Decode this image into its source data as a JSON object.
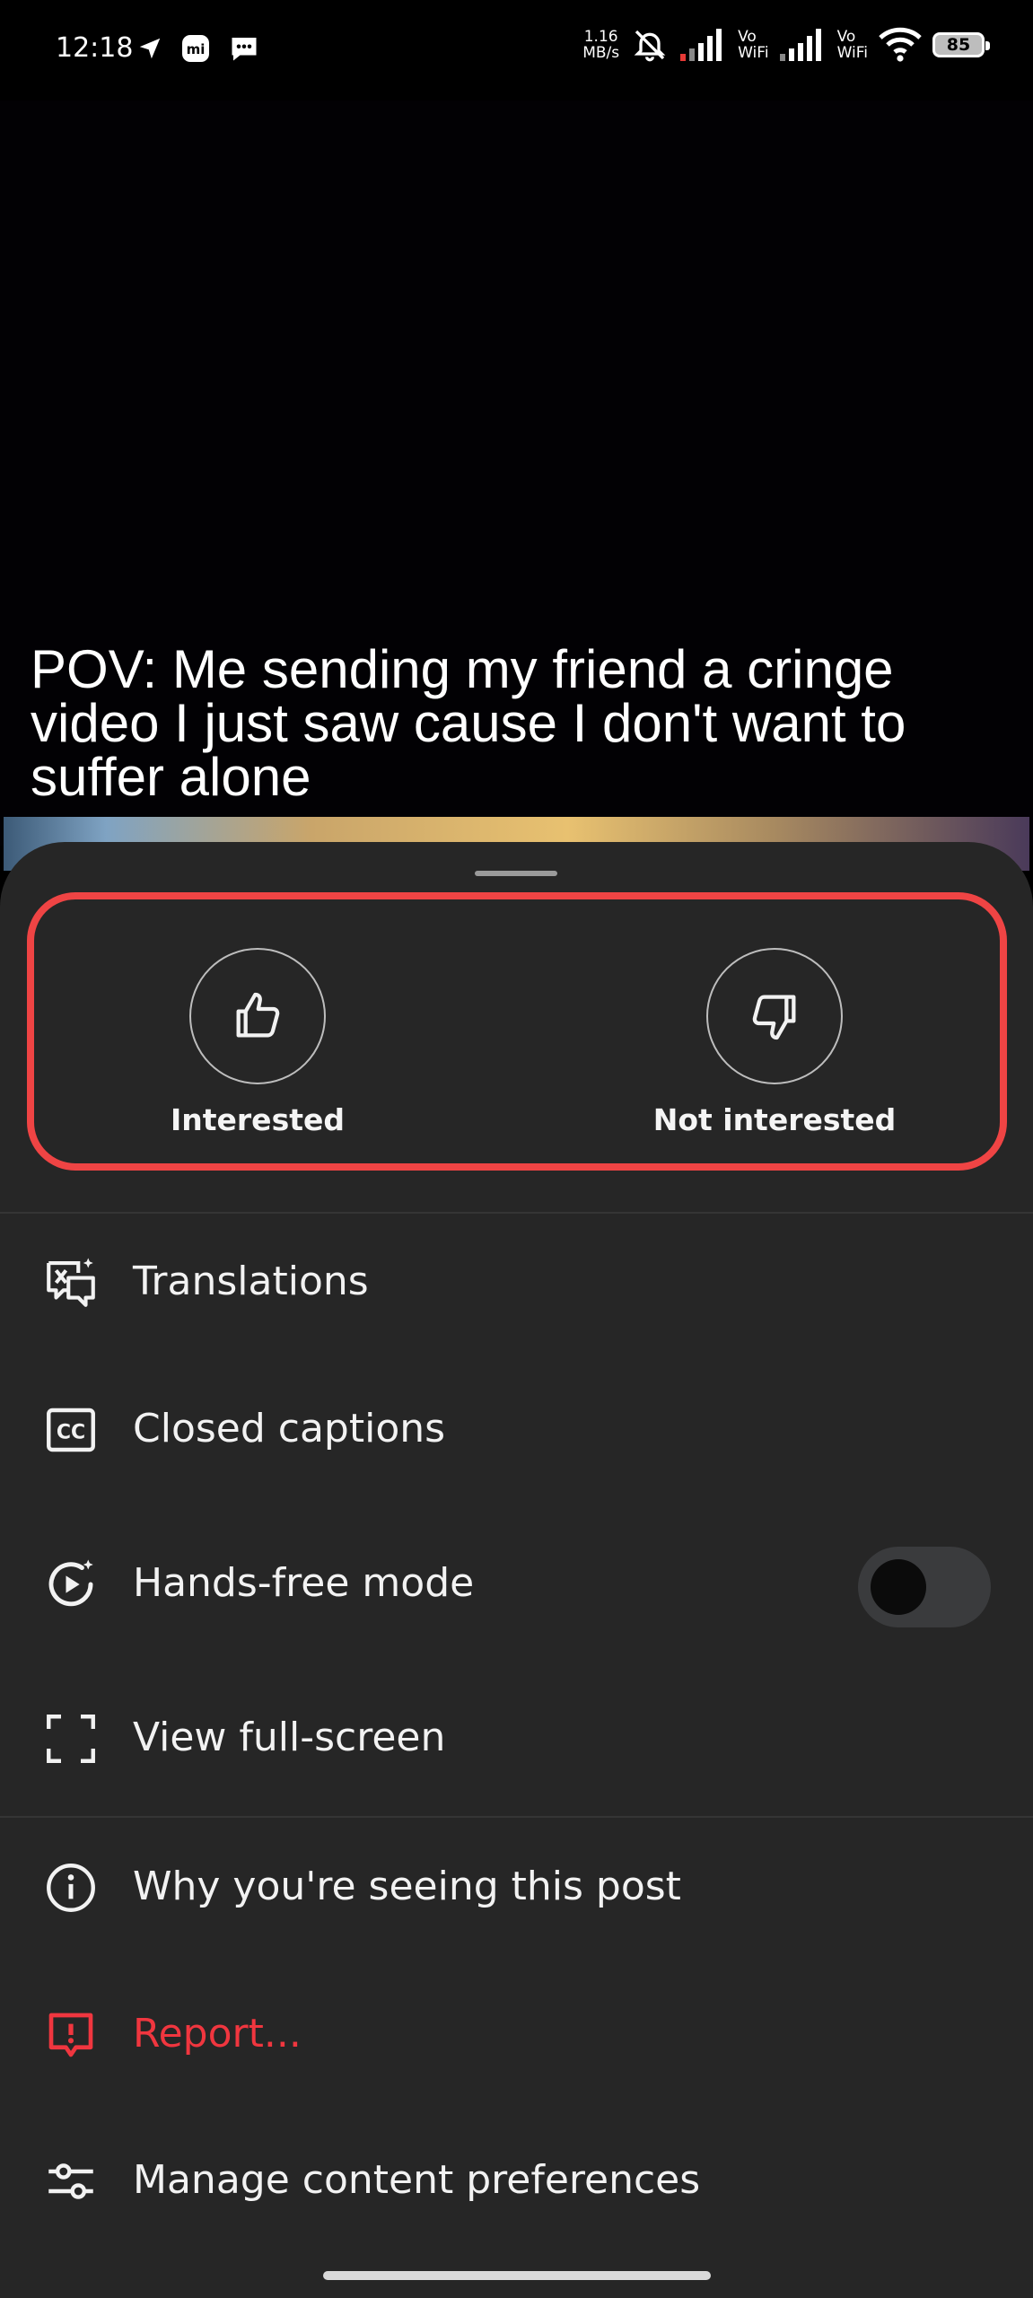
{
  "status_bar": {
    "time": "12:18",
    "net_speed_value": "1.16",
    "net_speed_unit": "MB/s",
    "vo_wifi_1": "Vo",
    "vo_wifi_1_sub": "WiFi",
    "vo_wifi_2": "Vo",
    "vo_wifi_2_sub": "WiFi",
    "battery": "85"
  },
  "video": {
    "caption": "POV: Me sending my friend a cringe video I just saw cause I don't want to suffer alone"
  },
  "sheet": {
    "reactions": {
      "interested_label": "Interested",
      "not_interested_label": "Not interested"
    },
    "menu": {
      "translations": "Translations",
      "closed_captions": "Closed captions",
      "hands_free": "Hands-free mode",
      "hands_free_enabled": false,
      "full_screen": "View full-screen",
      "why_seeing": "Why you're seeing this post",
      "report": "Report...",
      "manage_prefs": "Manage content preferences"
    }
  },
  "colors": {
    "sheet_bg": "#262626",
    "highlight": "#ef4444",
    "danger": "#f0363f"
  }
}
